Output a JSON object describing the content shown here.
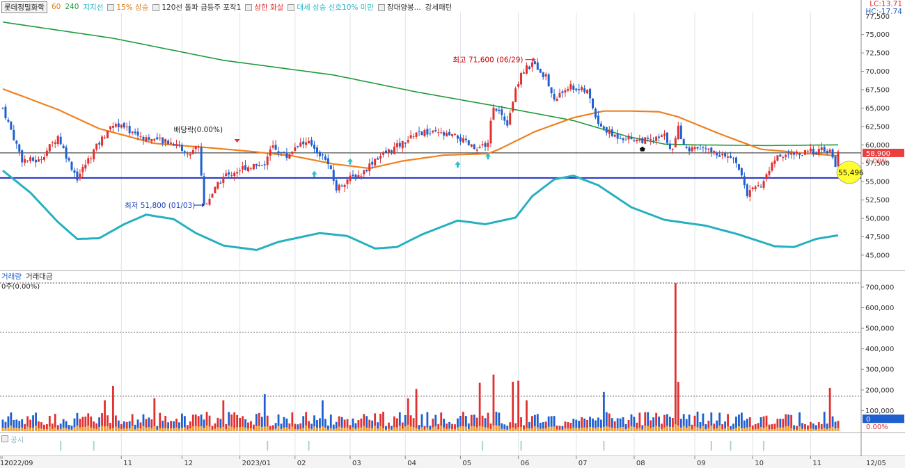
{
  "stock_name": "롯데정밀화학",
  "legend": [
    {
      "label": "60",
      "color": "#e07b1a"
    },
    {
      "label": "240",
      "color": "#1f9a3a"
    },
    {
      "label": "지지선",
      "color": "#27b4c4"
    },
    {
      "label": "15% 상승",
      "color": "#e07b1a"
    },
    {
      "label": "120선 돌파 급등주 포착1",
      "color": "#222222"
    },
    {
      "label": "상한 화살",
      "color": "#e03030"
    },
    {
      "label": "대세 상승 신호10% 미만",
      "color": "#27b4c4"
    },
    {
      "label": "장대양봉...",
      "color": "#222222"
    },
    {
      "label": "강세패턴",
      "color": "#222222"
    }
  ],
  "right_info": {
    "lc": "LC:13.71",
    "hc": "HC:-17.74"
  },
  "volume_panel": {
    "tab1": "거래량",
    "tab2": "거래대금",
    "info": "0주(0.00%)"
  },
  "notice_panel": {
    "label": "공시"
  },
  "colors": {
    "up": "#e03030",
    "down": "#1f5fd0",
    "ma60": "#f08020",
    "ma240": "#1f9a3a",
    "support": "#26b0bf",
    "hline": "#1e2fc0",
    "vol_orange": "#f2a030"
  },
  "chart_data": {
    "type": "candlestick",
    "price_axis": {
      "ylim": [
        43000,
        78000
      ],
      "ticks": [
        45000,
        47500,
        50000,
        52500,
        55000,
        57500,
        60000,
        62500,
        65000,
        67500,
        70000,
        72500,
        75000
      ]
    },
    "volume_axis": {
      "ylim": [
        0,
        730000
      ],
      "ticks": [
        100000,
        200000,
        300000,
        400000,
        500000,
        600000,
        700000
      ],
      "dashed_levels": [
        720000,
        480000,
        170000
      ]
    },
    "x_axis": {
      "labels": [
        "2022/09",
        "11",
        "12",
        "2023/01",
        "02",
        "03",
        "04",
        "05",
        "06",
        "07",
        "08",
        "09",
        "10",
        "11",
        "12"
      ],
      "right_label": "12/05"
    },
    "current_price": "58,900",
    "current_change": "0.00%",
    "support_price": "55,496",
    "current_volume": "0",
    "current_volume_change": "0.00%",
    "horizontal_lines": [
      58900,
      55496
    ],
    "annotations": {
      "high": "최고 71,600 (06/29)",
      "low": "최저 51,800 (01/03)",
      "dividend": "배당락(0.00%)"
    },
    "high_value": 71600,
    "low_value": 51800,
    "ma240_keypoints": [
      [
        0,
        76700
      ],
      [
        40,
        74500
      ],
      [
        80,
        71500
      ],
      [
        120,
        69500
      ],
      [
        150,
        67200
      ],
      [
        180,
        65200
      ],
      [
        207,
        63300
      ],
      [
        226,
        61200
      ],
      [
        240,
        60100
      ],
      [
        250,
        60000
      ],
      [
        277,
        59900
      ],
      [
        303,
        60000
      ]
    ],
    "ma60_keypoints": [
      [
        0,
        67600
      ],
      [
        8,
        66500
      ],
      [
        20,
        64800
      ],
      [
        35,
        62200
      ],
      [
        55,
        60200
      ],
      [
        75,
        59600
      ],
      [
        90,
        59100
      ],
      [
        105,
        58500
      ],
      [
        120,
        57400
      ],
      [
        133,
        56800
      ],
      [
        145,
        57800
      ],
      [
        160,
        58600
      ],
      [
        176,
        58800
      ],
      [
        180,
        59400
      ],
      [
        193,
        61800
      ],
      [
        207,
        63700
      ],
      [
        218,
        64600
      ],
      [
        228,
        64600
      ],
      [
        238,
        64500
      ],
      [
        245,
        63800
      ],
      [
        260,
        61500
      ],
      [
        275,
        59400
      ],
      [
        290,
        58900
      ],
      [
        303,
        58500
      ]
    ],
    "support_keypoints": [
      [
        0,
        56500
      ],
      [
        10,
        53500
      ],
      [
        20,
        49500
      ],
      [
        27,
        47200
      ],
      [
        35,
        47300
      ],
      [
        44,
        49200
      ],
      [
        52,
        50500
      ],
      [
        62,
        49900
      ],
      [
        70,
        48000
      ],
      [
        80,
        46300
      ],
      [
        92,
        45700
      ],
      [
        100,
        46800
      ],
      [
        115,
        48000
      ],
      [
        125,
        47600
      ],
      [
        135,
        45900
      ],
      [
        143,
        46100
      ],
      [
        152,
        47800
      ],
      [
        165,
        49700
      ],
      [
        175,
        49200
      ],
      [
        186,
        50100
      ],
      [
        192,
        53000
      ],
      [
        200,
        55300
      ],
      [
        207,
        55800
      ],
      [
        216,
        54500
      ],
      [
        228,
        51500
      ],
      [
        240,
        49800
      ],
      [
        255,
        49000
      ],
      [
        267,
        47800
      ],
      [
        280,
        46200
      ],
      [
        287,
        46100
      ],
      [
        295,
        47200
      ],
      [
        303,
        47700
      ]
    ],
    "price_keypoints": [
      [
        0,
        65000
      ],
      [
        7,
        58000
      ],
      [
        13,
        57800
      ],
      [
        20,
        61200
      ],
      [
        24,
        57700
      ],
      [
        27,
        55500
      ],
      [
        33,
        59200
      ],
      [
        40,
        63000
      ],
      [
        50,
        61200
      ],
      [
        58,
        60400
      ],
      [
        63,
        60200
      ],
      [
        67,
        58600
      ],
      [
        71,
        60000
      ],
      [
        73,
        51800
      ],
      [
        80,
        55600
      ],
      [
        88,
        57000
      ],
      [
        95,
        57500
      ],
      [
        98,
        59800
      ],
      [
        103,
        58400
      ],
      [
        107,
        60200
      ],
      [
        112,
        60100
      ],
      [
        118,
        57400
      ],
      [
        121,
        54000
      ],
      [
        125,
        55300
      ],
      [
        130,
        56000
      ],
      [
        135,
        58100
      ],
      [
        145,
        60200
      ],
      [
        150,
        61700
      ],
      [
        158,
        61500
      ],
      [
        165,
        61000
      ],
      [
        172,
        59200
      ],
      [
        176,
        60500
      ],
      [
        178,
        65500
      ],
      [
        183,
        63000
      ],
      [
        185,
        66000
      ],
      [
        188,
        70000
      ],
      [
        193,
        71000
      ],
      [
        197,
        69200
      ],
      [
        200,
        66000
      ],
      [
        205,
        68000
      ],
      [
        212,
        67200
      ],
      [
        216,
        63000
      ],
      [
        221,
        61300
      ],
      [
        229,
        60800
      ],
      [
        235,
        60500
      ],
      [
        240,
        61200
      ],
      [
        243,
        59200
      ],
      [
        245,
        62200
      ],
      [
        248,
        59200
      ],
      [
        253,
        59500
      ],
      [
        260,
        58700
      ],
      [
        266,
        57800
      ],
      [
        270,
        53300
      ],
      [
        275,
        54500
      ],
      [
        281,
        58600
      ],
      [
        290,
        58800
      ],
      [
        296,
        59300
      ],
      [
        300,
        59000
      ],
      [
        302,
        57400
      ],
      [
        303,
        58900
      ]
    ],
    "volume_spikes": [
      [
        37,
        150000
      ],
      [
        40,
        220000
      ],
      [
        55,
        160000
      ],
      [
        80,
        150000
      ],
      [
        95,
        180000
      ],
      [
        116,
        150000
      ],
      [
        147,
        160000
      ],
      [
        150,
        205000
      ],
      [
        173,
        235000
      ],
      [
        178,
        275000
      ],
      [
        185,
        240000
      ],
      [
        187,
        245000
      ],
      [
        190,
        150000
      ],
      [
        218,
        190000
      ],
      [
        244,
        720000
      ],
      [
        245,
        240000
      ],
      [
        300,
        210000
      ]
    ],
    "notice_days": [
      21,
      33,
      96,
      111,
      174,
      188,
      218,
      257,
      264,
      276
    ]
  }
}
